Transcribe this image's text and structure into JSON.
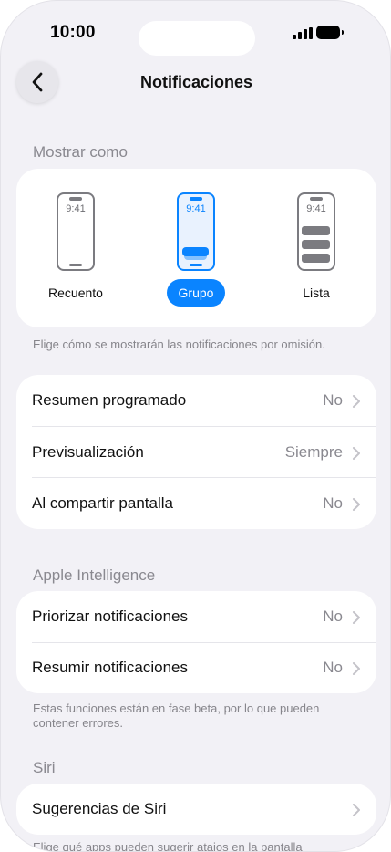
{
  "status": {
    "time": "10:00"
  },
  "nav": {
    "title": "Notificaciones"
  },
  "display": {
    "header": "Mostrar como",
    "options": [
      {
        "label": "Recuento",
        "time": "9:41",
        "selected": false
      },
      {
        "label": "Grupo",
        "time": "9:41",
        "selected": true
      },
      {
        "label": "Lista",
        "time": "9:41",
        "selected": false
      }
    ],
    "footnote": "Elige cómo se mostrarán las notificaciones por omisión."
  },
  "general_rows": [
    {
      "label": "Resumen programado",
      "value": "No"
    },
    {
      "label": "Previsualización",
      "value": "Siempre"
    },
    {
      "label": "Al compartir pantalla",
      "value": "No"
    }
  ],
  "ai": {
    "header": "Apple Intelligence",
    "rows": [
      {
        "label": "Priorizar notificaciones",
        "value": "No"
      },
      {
        "label": "Resumir notificaciones",
        "value": "No"
      }
    ],
    "footnote": "Estas funciones están en fase beta, por lo que pueden contener errores."
  },
  "siri": {
    "header": "Siri",
    "rows": [
      {
        "label": "Sugerencias de Siri",
        "value": ""
      }
    ],
    "footnote": "Elige qué apps pueden sugerir atajos en la pantalla"
  },
  "colors": {
    "accent": "#0a84ff",
    "background": "#f2f1f6",
    "secondary_text": "#8a8990"
  }
}
